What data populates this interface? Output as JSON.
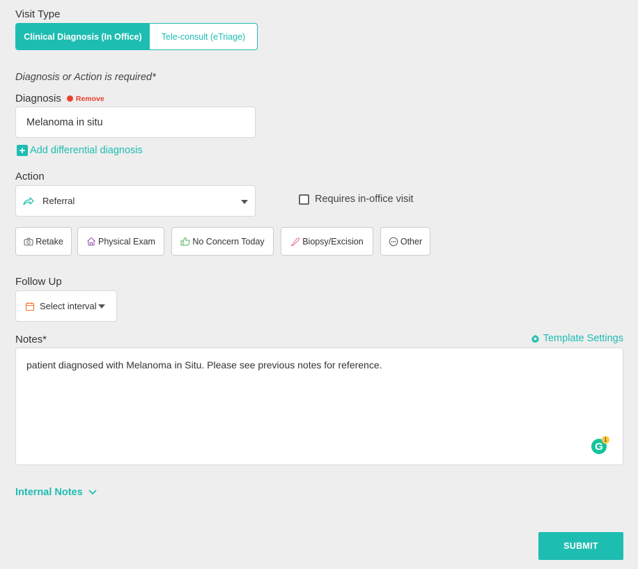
{
  "visit_type": {
    "label": "Visit Type",
    "options": [
      "Clinical Diagnosis (In Office)",
      "Tele-consult (eTriage)"
    ],
    "selected": "Clinical Diagnosis (In Office)"
  },
  "required_note": "Diagnosis or Action is required*",
  "diagnosis": {
    "label": "Diagnosis",
    "remove_label": "Remove",
    "value": "Melanoma in situ",
    "add_differential_label": "Add differential diagnosis"
  },
  "action": {
    "label": "Action",
    "selected": "Referral",
    "requires_visit_label": "Requires in-office visit",
    "requires_visit_checked": false,
    "quick_buttons": [
      "Retake",
      "Physical Exam",
      "No Concern Today",
      "Biopsy/Excision",
      "Other"
    ]
  },
  "follow_up": {
    "label": "Follow Up",
    "placeholder": "Select interval"
  },
  "notes": {
    "label": "Notes*",
    "template_settings_label": "Template Settings",
    "value": "patient diagnosed with Melanoma in Situ. Please see previous notes for reference.",
    "grammarly_letter": "G",
    "grammarly_count": "1"
  },
  "internal_notes_label": "Internal Notes",
  "submit_label": "SUBMIT",
  "colors": {
    "accent": "#1ebdb1",
    "remove": "#e8422f",
    "background": "#eeeeee"
  }
}
